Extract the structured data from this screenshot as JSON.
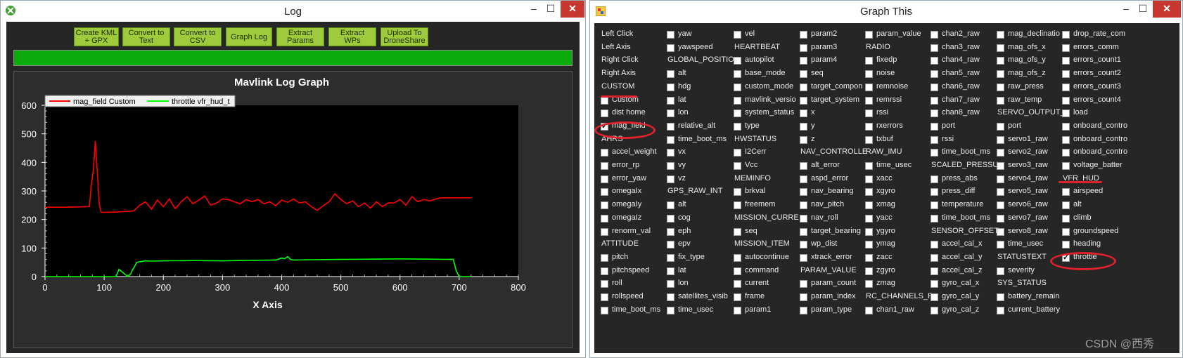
{
  "log_window": {
    "title": "Log",
    "buttons": [
      "Create KML + GPX",
      "Convert to Text",
      "Convert to CSV",
      "Graph Log",
      "Extract Params",
      "Extract WPs",
      "Upload To DroneShare"
    ],
    "button_lines": [
      [
        "Create KML",
        "+ GPX"
      ],
      [
        "Convert to",
        "Text"
      ],
      [
        "Convert to",
        "CSV"
      ],
      [
        "Graph Log"
      ],
      [
        "Extract",
        "Params"
      ],
      [
        "Extract",
        "WPs"
      ],
      [
        "Upload To",
        "DroneShare"
      ]
    ],
    "progress": 1.0,
    "controls": {
      "minimize": "–",
      "maximize": "☐",
      "close": "✕"
    }
  },
  "chart_data": {
    "type": "line",
    "title": "Mavlink Log Graph",
    "xlabel": "X Axis",
    "ylabel": "",
    "xlim": [
      0,
      800
    ],
    "ylim": [
      0,
      600
    ],
    "x_ticks": [
      0,
      100,
      200,
      300,
      400,
      500,
      600,
      700,
      800
    ],
    "y_ticks": [
      0,
      100,
      200,
      300,
      400,
      500,
      600
    ],
    "legend_position": "top-left",
    "series": [
      {
        "name": "mag_field Custom",
        "color": "#ff0000",
        "x": [
          0,
          40,
          75,
          78,
          82,
          85,
          87,
          90,
          92,
          95,
          100,
          120,
          150,
          160,
          170,
          180,
          190,
          200,
          210,
          220,
          230,
          240,
          250,
          260,
          270,
          280,
          290,
          300,
          310,
          320,
          330,
          340,
          350,
          360,
          370,
          380,
          390,
          400,
          410,
          420,
          430,
          440,
          450,
          460,
          470,
          480,
          490,
          500,
          510,
          520,
          530,
          540,
          550,
          560,
          570,
          580,
          590,
          600,
          610,
          620,
          630,
          640,
          650,
          660,
          670,
          680,
          690,
          700,
          720
        ],
        "y": [
          243,
          243,
          245,
          315,
          380,
          475,
          410,
          310,
          250,
          225,
          225,
          226,
          230,
          250,
          262,
          236,
          268,
          245,
          272,
          238,
          262,
          280,
          255,
          268,
          282,
          250,
          258,
          272,
          270,
          262,
          255,
          270,
          262,
          270,
          255,
          262,
          248,
          268,
          260,
          272,
          258,
          262,
          245,
          232,
          248,
          262,
          290,
          270,
          255,
          265,
          245,
          258,
          240,
          262,
          245,
          258,
          258,
          270,
          250,
          280,
          262,
          270,
          265,
          272,
          276,
          276,
          276,
          276,
          276
        ]
      },
      {
        "name": "throttle vfr_hud_t",
        "color": "#00ff00",
        "x": [
          0,
          120,
          125,
          140,
          145,
          148,
          150,
          155,
          160,
          170,
          180,
          200,
          250,
          300,
          350,
          390,
          400,
          405,
          410,
          415,
          420,
          450,
          500,
          550,
          600,
          650,
          690,
          695,
          700,
          720
        ],
        "y": [
          0,
          0,
          25,
          0,
          10,
          25,
          30,
          50,
          52,
          55,
          54,
          55,
          56,
          55,
          57,
          58,
          65,
          62,
          70,
          60,
          58,
          59,
          60,
          61,
          62,
          61,
          60,
          20,
          0,
          0
        ]
      }
    ]
  },
  "graph_window": {
    "title": "Graph This",
    "controls": {
      "minimize": "–",
      "maximize": "☐",
      "close": "✕"
    },
    "columns": [
      [
        {
          "t": "h",
          "l": "Left Click"
        },
        {
          "t": "h",
          "l": "Left Axis"
        },
        {
          "t": "h",
          "l": "Right Click"
        },
        {
          "t": "h",
          "l": "Right Axis"
        },
        {
          "t": "h",
          "l": "CUSTOM"
        },
        {
          "t": "c",
          "l": "Custom",
          "c": false
        },
        {
          "t": "c",
          "l": "dist home",
          "c": false
        },
        {
          "t": "c",
          "l": "mag_field",
          "c": true
        },
        {
          "t": "h",
          "l": "AHRS"
        },
        {
          "t": "c",
          "l": "accel_weight",
          "c": false
        },
        {
          "t": "c",
          "l": "error_rp",
          "c": false
        },
        {
          "t": "c",
          "l": "error_yaw",
          "c": false
        },
        {
          "t": "c",
          "l": "omegaIx",
          "c": false
        },
        {
          "t": "c",
          "l": "omegaIy",
          "c": false
        },
        {
          "t": "c",
          "l": "omegaIz",
          "c": false
        },
        {
          "t": "c",
          "l": "renorm_val",
          "c": false
        },
        {
          "t": "h",
          "l": "ATTITUDE"
        },
        {
          "t": "c",
          "l": "pitch",
          "c": false
        },
        {
          "t": "c",
          "l": "pitchspeed",
          "c": false
        },
        {
          "t": "c",
          "l": "roll",
          "c": false
        },
        {
          "t": "c",
          "l": "rollspeed",
          "c": false
        },
        {
          "t": "c",
          "l": "time_boot_ms",
          "c": false
        }
      ],
      [
        {
          "t": "c",
          "l": "yaw",
          "c": false
        },
        {
          "t": "c",
          "l": "yawspeed",
          "c": false
        },
        {
          "t": "h",
          "l": "GLOBAL_POSITIO"
        },
        {
          "t": "c",
          "l": "alt",
          "c": false
        },
        {
          "t": "c",
          "l": "hdg",
          "c": false
        },
        {
          "t": "c",
          "l": "lat",
          "c": false
        },
        {
          "t": "c",
          "l": "lon",
          "c": false
        },
        {
          "t": "c",
          "l": "relative_alt",
          "c": false
        },
        {
          "t": "c",
          "l": "time_boot_ms",
          "c": false
        },
        {
          "t": "c",
          "l": "vx",
          "c": false
        },
        {
          "t": "c",
          "l": "vy",
          "c": false
        },
        {
          "t": "c",
          "l": "vz",
          "c": false
        },
        {
          "t": "h",
          "l": "GPS_RAW_INT"
        },
        {
          "t": "c",
          "l": "alt",
          "c": false
        },
        {
          "t": "c",
          "l": "cog",
          "c": false
        },
        {
          "t": "c",
          "l": "eph",
          "c": false
        },
        {
          "t": "c",
          "l": "epv",
          "c": false
        },
        {
          "t": "c",
          "l": "fix_type",
          "c": false
        },
        {
          "t": "c",
          "l": "lat",
          "c": false
        },
        {
          "t": "c",
          "l": "lon",
          "c": false
        },
        {
          "t": "c",
          "l": "satellites_visib",
          "c": false
        },
        {
          "t": "c",
          "l": "time_usec",
          "c": false
        }
      ],
      [
        {
          "t": "c",
          "l": "vel",
          "c": false
        },
        {
          "t": "h",
          "l": "HEARTBEAT"
        },
        {
          "t": "c",
          "l": "autopilot",
          "c": false
        },
        {
          "t": "c",
          "l": "base_mode",
          "c": false
        },
        {
          "t": "c",
          "l": "custom_mode",
          "c": false
        },
        {
          "t": "c",
          "l": "mavlink_versio",
          "c": false
        },
        {
          "t": "c",
          "l": "system_status",
          "c": false
        },
        {
          "t": "c",
          "l": "type",
          "c": false
        },
        {
          "t": "h",
          "l": "HWSTATUS"
        },
        {
          "t": "c",
          "l": "I2Cerr",
          "c": false
        },
        {
          "t": "c",
          "l": "Vcc",
          "c": false
        },
        {
          "t": "h",
          "l": "MEMINFO"
        },
        {
          "t": "c",
          "l": "brkval",
          "c": false
        },
        {
          "t": "c",
          "l": "freemem",
          "c": false
        },
        {
          "t": "h",
          "l": "MISSION_CURRE"
        },
        {
          "t": "c",
          "l": "seq",
          "c": false
        },
        {
          "t": "h",
          "l": "MISSION_ITEM"
        },
        {
          "t": "c",
          "l": "autocontinue",
          "c": false
        },
        {
          "t": "c",
          "l": "command",
          "c": false
        },
        {
          "t": "c",
          "l": "current",
          "c": false
        },
        {
          "t": "c",
          "l": "frame",
          "c": false
        },
        {
          "t": "c",
          "l": "param1",
          "c": false
        }
      ],
      [
        {
          "t": "c",
          "l": "param2",
          "c": false
        },
        {
          "t": "c",
          "l": "param3",
          "c": false
        },
        {
          "t": "c",
          "l": "param4",
          "c": false
        },
        {
          "t": "c",
          "l": "seq",
          "c": false
        },
        {
          "t": "c",
          "l": "target_compon",
          "c": false
        },
        {
          "t": "c",
          "l": "target_system",
          "c": false
        },
        {
          "t": "c",
          "l": "x",
          "c": false
        },
        {
          "t": "c",
          "l": "y",
          "c": false
        },
        {
          "t": "c",
          "l": "z",
          "c": false
        },
        {
          "t": "h",
          "l": "NAV_CONTROLLE"
        },
        {
          "t": "c",
          "l": "alt_error",
          "c": false
        },
        {
          "t": "c",
          "l": "aspd_error",
          "c": false
        },
        {
          "t": "c",
          "l": "nav_bearing",
          "c": false
        },
        {
          "t": "c",
          "l": "nav_pitch",
          "c": false
        },
        {
          "t": "c",
          "l": "nav_roll",
          "c": false
        },
        {
          "t": "c",
          "l": "target_bearing",
          "c": false
        },
        {
          "t": "c",
          "l": "wp_dist",
          "c": false
        },
        {
          "t": "c",
          "l": "xtrack_error",
          "c": false
        },
        {
          "t": "h",
          "l": "PARAM_VALUE"
        },
        {
          "t": "c",
          "l": "param_count",
          "c": false
        },
        {
          "t": "c",
          "l": "param_index",
          "c": false
        },
        {
          "t": "c",
          "l": "param_type",
          "c": false
        }
      ],
      [
        {
          "t": "c",
          "l": "param_value",
          "c": false
        },
        {
          "t": "h",
          "l": "RADIO"
        },
        {
          "t": "c",
          "l": "fixedp",
          "c": false
        },
        {
          "t": "c",
          "l": "noise",
          "c": false
        },
        {
          "t": "c",
          "l": "remnoise",
          "c": false
        },
        {
          "t": "c",
          "l": "remrssi",
          "c": false
        },
        {
          "t": "c",
          "l": "rssi",
          "c": false
        },
        {
          "t": "c",
          "l": "rxerrors",
          "c": false
        },
        {
          "t": "c",
          "l": "txbuf",
          "c": false
        },
        {
          "t": "h",
          "l": "RAW_IMU"
        },
        {
          "t": "c",
          "l": "time_usec",
          "c": false
        },
        {
          "t": "c",
          "l": "xacc",
          "c": false
        },
        {
          "t": "c",
          "l": "xgyro",
          "c": false
        },
        {
          "t": "c",
          "l": "xmag",
          "c": false
        },
        {
          "t": "c",
          "l": "yacc",
          "c": false
        },
        {
          "t": "c",
          "l": "ygyro",
          "c": false
        },
        {
          "t": "c",
          "l": "ymag",
          "c": false
        },
        {
          "t": "c",
          "l": "zacc",
          "c": false
        },
        {
          "t": "c",
          "l": "zgyro",
          "c": false
        },
        {
          "t": "c",
          "l": "zmag",
          "c": false
        },
        {
          "t": "h",
          "l": "RC_CHANNELS_R"
        },
        {
          "t": "c",
          "l": "chan1_raw",
          "c": false
        }
      ],
      [
        {
          "t": "c",
          "l": "chan2_raw",
          "c": false
        },
        {
          "t": "c",
          "l": "chan3_raw",
          "c": false
        },
        {
          "t": "c",
          "l": "chan4_raw",
          "c": false
        },
        {
          "t": "c",
          "l": "chan5_raw",
          "c": false
        },
        {
          "t": "c",
          "l": "chan6_raw",
          "c": false
        },
        {
          "t": "c",
          "l": "chan7_raw",
          "c": false
        },
        {
          "t": "c",
          "l": "chan8_raw",
          "c": false
        },
        {
          "t": "c",
          "l": "port",
          "c": false
        },
        {
          "t": "c",
          "l": "rssi",
          "c": false
        },
        {
          "t": "c",
          "l": "time_boot_ms",
          "c": false
        },
        {
          "t": "h",
          "l": "SCALED_PRESSU"
        },
        {
          "t": "c",
          "l": "press_abs",
          "c": false
        },
        {
          "t": "c",
          "l": "press_diff",
          "c": false
        },
        {
          "t": "c",
          "l": "temperature",
          "c": false
        },
        {
          "t": "c",
          "l": "time_boot_ms",
          "c": false
        },
        {
          "t": "h",
          "l": "SENSOR_OFFSET"
        },
        {
          "t": "c",
          "l": "accel_cal_x",
          "c": false
        },
        {
          "t": "c",
          "l": "accel_cal_y",
          "c": false
        },
        {
          "t": "c",
          "l": "accel_cal_z",
          "c": false
        },
        {
          "t": "c",
          "l": "gyro_cal_x",
          "c": false
        },
        {
          "t": "c",
          "l": "gyro_cal_y",
          "c": false
        },
        {
          "t": "c",
          "l": "gyro_cal_z",
          "c": false
        }
      ],
      [
        {
          "t": "c",
          "l": "mag_declinatio",
          "c": false
        },
        {
          "t": "c",
          "l": "mag_ofs_x",
          "c": false
        },
        {
          "t": "c",
          "l": "mag_ofs_y",
          "c": false
        },
        {
          "t": "c",
          "l": "mag_ofs_z",
          "c": false
        },
        {
          "t": "c",
          "l": "raw_press",
          "c": false
        },
        {
          "t": "c",
          "l": "raw_temp",
          "c": false
        },
        {
          "t": "h",
          "l": "SERVO_OUTPUT_"
        },
        {
          "t": "c",
          "l": "port",
          "c": false
        },
        {
          "t": "c",
          "l": "servo1_raw",
          "c": false
        },
        {
          "t": "c",
          "l": "servo2_raw",
          "c": false
        },
        {
          "t": "c",
          "l": "servo3_raw",
          "c": false
        },
        {
          "t": "c",
          "l": "servo4_raw",
          "c": false
        },
        {
          "t": "c",
          "l": "servo5_raw",
          "c": false
        },
        {
          "t": "c",
          "l": "servo6_raw",
          "c": false
        },
        {
          "t": "c",
          "l": "servo7_raw",
          "c": false
        },
        {
          "t": "c",
          "l": "servo8_raw",
          "c": false
        },
        {
          "t": "c",
          "l": "time_usec",
          "c": false
        },
        {
          "t": "h",
          "l": "STATUSTEXT"
        },
        {
          "t": "c",
          "l": "severity",
          "c": false
        },
        {
          "t": "h",
          "l": "SYS_STATUS"
        },
        {
          "t": "c",
          "l": "battery_remain",
          "c": false
        },
        {
          "t": "c",
          "l": "current_battery",
          "c": false
        }
      ],
      [
        {
          "t": "c",
          "l": "drop_rate_com",
          "c": false
        },
        {
          "t": "c",
          "l": "errors_comm",
          "c": false
        },
        {
          "t": "c",
          "l": "errors_count1",
          "c": false
        },
        {
          "t": "c",
          "l": "errors_count2",
          "c": false
        },
        {
          "t": "c",
          "l": "errors_count3",
          "c": false
        },
        {
          "t": "c",
          "l": "errors_count4",
          "c": false
        },
        {
          "t": "c",
          "l": "load",
          "c": false
        },
        {
          "t": "c",
          "l": "onboard_contro",
          "c": false
        },
        {
          "t": "c",
          "l": "onboard_contro",
          "c": false
        },
        {
          "t": "c",
          "l": "onboard_contro",
          "c": false
        },
        {
          "t": "c",
          "l": "voltage_batter",
          "c": false
        },
        {
          "t": "h",
          "l": "VFR_HUD"
        },
        {
          "t": "c",
          "l": "airspeed",
          "c": false
        },
        {
          "t": "c",
          "l": "alt",
          "c": false
        },
        {
          "t": "c",
          "l": "climb",
          "c": false
        },
        {
          "t": "c",
          "l": "groundspeed",
          "c": false
        },
        {
          "t": "c",
          "l": "heading",
          "c": false
        },
        {
          "t": "c",
          "l": "throttle",
          "c": true
        }
      ]
    ]
  },
  "watermark": "CSDN @西秀"
}
